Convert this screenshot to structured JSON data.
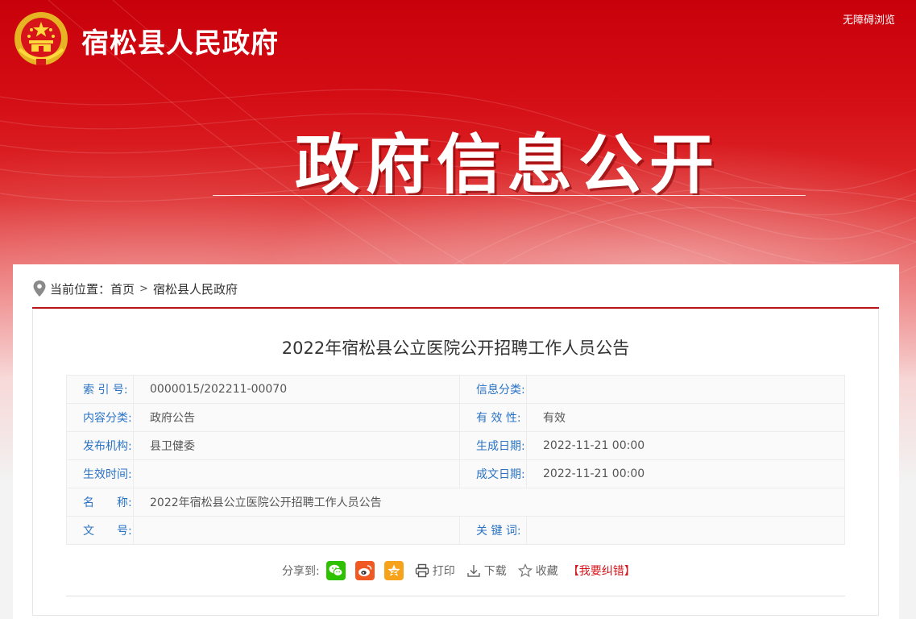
{
  "header": {
    "site_name": "宿松县人民政府",
    "accessibility_label": "无障碍浏览",
    "banner_title": "政府信息公开"
  },
  "breadcrumb": {
    "prefix": "当前位置：",
    "items": [
      "首页",
      "宿松县人民政府"
    ],
    "separator": ">"
  },
  "article": {
    "title": "2022年宿松县公立医院公开招聘工作人员公告"
  },
  "meta": {
    "index_label": "索 引 号:",
    "index_value": "0000015/202211-00070",
    "category_label": "信息分类:",
    "category_value": "",
    "content_type_label": "内容分类:",
    "content_type_value": "政府公告",
    "validity_label": "有 效 性:",
    "validity_value": "有效",
    "publisher_label": "发布机构:",
    "publisher_value": "县卫健委",
    "generated_label": "生成日期:",
    "generated_value": "2022-11-21 00:00",
    "effective_label": "生效时间:",
    "effective_value": "",
    "written_label": "成文日期:",
    "written_value": "2022-11-21 00:00",
    "name_label": "名　　称:",
    "name_value": "2022年宿松县公立医院公开招聘工作人员公告",
    "doc_no_label": "文　　号:",
    "doc_no_value": "",
    "keywords_label": "关 键 词:",
    "keywords_value": ""
  },
  "share": {
    "label": "分享到:",
    "icons": [
      "wechat-icon",
      "weibo-icon",
      "qzone-icon"
    ],
    "print_label": "打印",
    "download_label": "下载",
    "favorite_label": "收藏",
    "report_label": "【我要纠错】"
  },
  "colors": {
    "brand_red": "#c8000b",
    "link_blue": "#2a73c4",
    "wechat_green": "#2dc100",
    "weibo_orange": "#f05a22",
    "qzone_orange": "#f7a21b"
  }
}
